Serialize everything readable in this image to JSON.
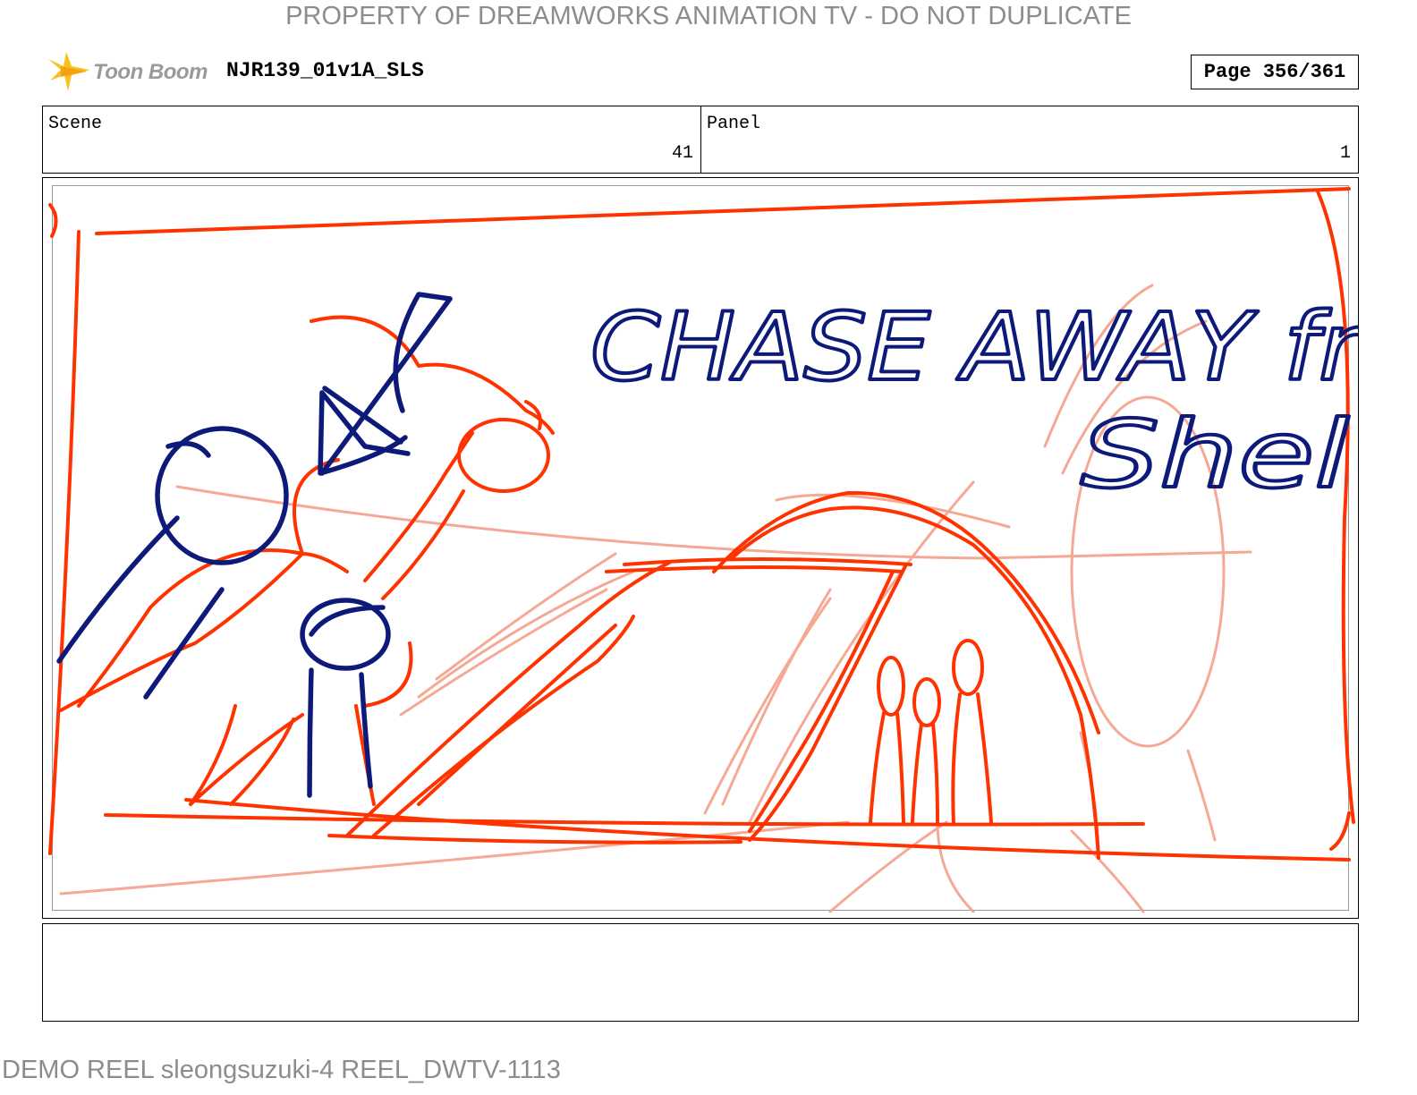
{
  "watermark": "PROPERTY OF DREAMWORKS ANIMATION TV - DO NOT DUPLICATE",
  "logo": {
    "text": "Toon Boom",
    "icon": "toon-boom-star-icon"
  },
  "project": {
    "title": "NJR139_01v1A_SLS"
  },
  "page": {
    "label": "Page 356/361"
  },
  "scene": {
    "label": "Scene",
    "value": "41"
  },
  "panel": {
    "label": "Panel",
    "value": "1"
  },
  "sketch": {
    "caption_line1": "CHASE AWAY fr",
    "caption_line2": "Shel",
    "colors": {
      "roughs": "#ff3300",
      "roughs_light": "#f5a08a",
      "ink": "#0d1a7a"
    }
  },
  "notes": {
    "text": ""
  },
  "footer": "DEMO REEL sleongsuzuki-4 REEL_DWTV-1113"
}
